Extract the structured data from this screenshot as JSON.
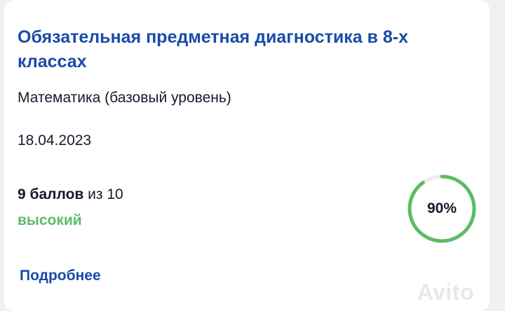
{
  "card": {
    "title": "Обязательная предметная диагностика в 8-х классах",
    "subject": "Математика (базовый уровень)",
    "date": "18.04.2023",
    "score": {
      "points": "9 баллов",
      "of_text": "из 10"
    },
    "level": {
      "label": "высокий",
      "color": "#5dbb63"
    },
    "progress": {
      "value": 0.9,
      "label": "90%",
      "color": "#5dbb63",
      "track_color": "#eceef1"
    },
    "more_link": "Подробнее",
    "watermark": "Avito"
  }
}
